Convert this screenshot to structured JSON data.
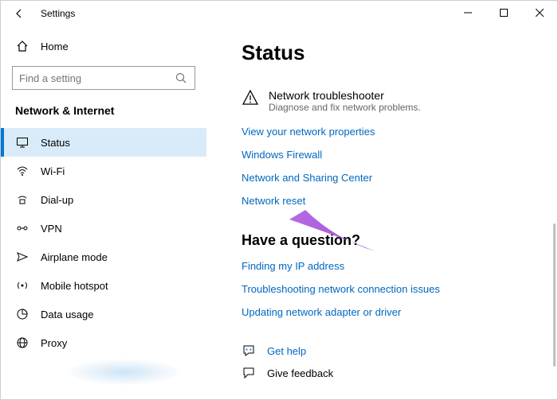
{
  "window": {
    "title": "Settings"
  },
  "sidebar": {
    "home": "Home",
    "search_placeholder": "Find a setting",
    "section": "Network & Internet",
    "items": [
      {
        "label": "Status"
      },
      {
        "label": "Wi-Fi"
      },
      {
        "label": "Dial-up"
      },
      {
        "label": "VPN"
      },
      {
        "label": "Airplane mode"
      },
      {
        "label": "Mobile hotspot"
      },
      {
        "label": "Data usage"
      },
      {
        "label": "Proxy"
      }
    ]
  },
  "main": {
    "heading": "Status",
    "troubleshooter": {
      "title": "Network troubleshooter",
      "subtitle": "Diagnose and fix network problems."
    },
    "links": [
      "View your network properties",
      "Windows Firewall",
      "Network and Sharing Center",
      "Network reset"
    ],
    "question_heading": "Have a question?",
    "question_links": [
      "Finding my IP address",
      "Troubleshooting network connection issues",
      "Updating network adapter or driver"
    ],
    "footer": {
      "get_help": "Get help",
      "feedback": "Give feedback"
    }
  }
}
